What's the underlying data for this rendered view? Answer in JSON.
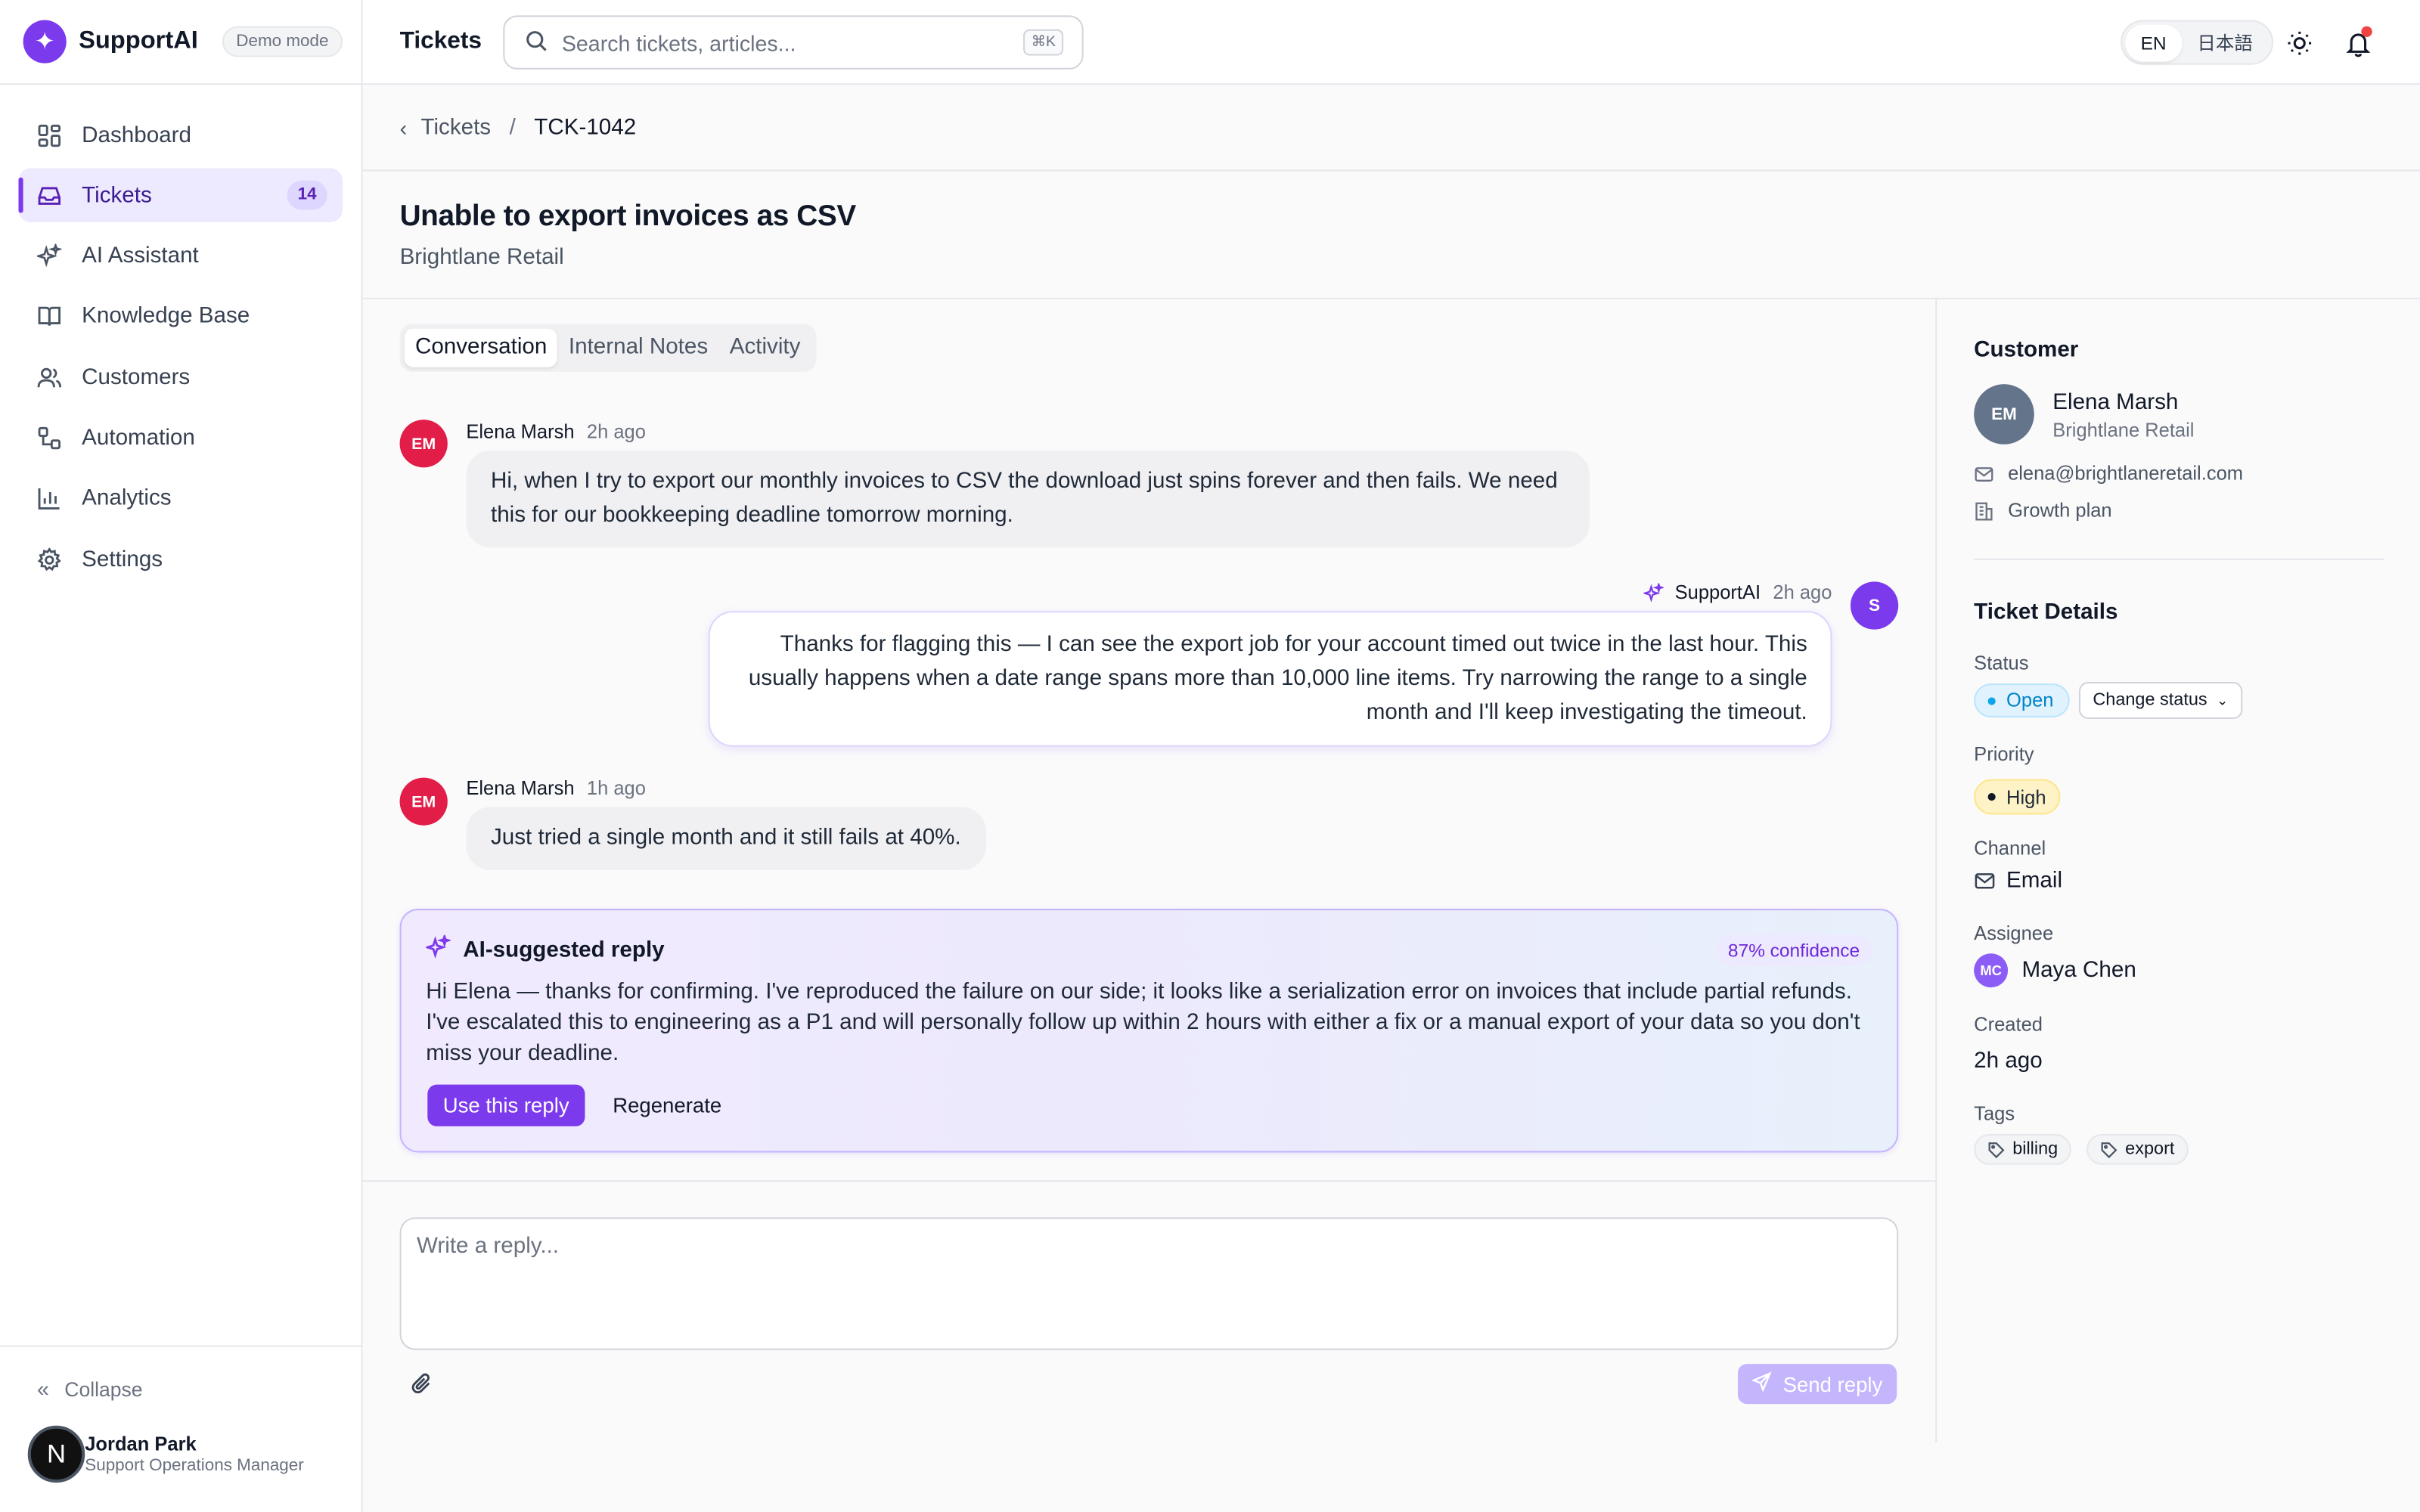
{
  "app": {
    "brand": "SupportAI",
    "mode_badge": "Demo mode",
    "accent": "#7c3aed"
  },
  "sidebar": {
    "items": [
      {
        "label": "Dashboard",
        "icon": "dashboard-icon"
      },
      {
        "label": "Tickets",
        "icon": "inbox-icon",
        "count": "14",
        "active": true
      },
      {
        "label": "AI Assistant",
        "icon": "sparkles-icon"
      },
      {
        "label": "Knowledge Base",
        "icon": "book-icon"
      },
      {
        "label": "Customers",
        "icon": "users-icon"
      },
      {
        "label": "Automation",
        "icon": "workflow-icon"
      },
      {
        "label": "Analytics",
        "icon": "bar-chart-icon"
      },
      {
        "label": "Settings",
        "icon": "gear-icon"
      }
    ],
    "collapse_label": "Collapse",
    "user": {
      "initial": "N",
      "name": "Jordan Park",
      "role": "Support Operations Manager"
    }
  },
  "header": {
    "title": "Tickets",
    "search_placeholder": "Search tickets, articles...",
    "search_shortcut": "⌘K",
    "languages": [
      "EN",
      "日本語"
    ],
    "active_language": "EN"
  },
  "breadcrumb": {
    "parent": "Tickets",
    "separator": "/",
    "current": "TCK-1042"
  },
  "ticket": {
    "title": "Unable to export invoices as CSV",
    "company": "Brightlane Retail"
  },
  "tabs": [
    "Conversation",
    "Internal Notes",
    "Activity"
  ],
  "messages": [
    {
      "author": "Elena Marsh",
      "initials": "EM",
      "time": "2h ago",
      "text": "Hi, when I try to export our monthly invoices to CSV the download just spins forever and then fails. We need this for our bookkeeping deadline tomorrow morning."
    },
    {
      "author": "SupportAI",
      "initials": "S",
      "time": "2h ago",
      "text": "Thanks for flagging this — I can see the export job for your account timed out twice in the last hour. This usually happens when a date range spans more than 10,000 line items. Try narrowing the range to a single month and I'll keep investigating the timeout."
    },
    {
      "author": "Elena Marsh",
      "initials": "EM",
      "time": "1h ago",
      "text": "Just tried a single month and it still fails at 40%."
    }
  ],
  "ai_suggestion": {
    "title": "AI-suggested reply",
    "confidence": "87% confidence",
    "text": "Hi Elena — thanks for confirming. I've reproduced the failure on our side; it looks like a serialization error on invoices that include partial refunds. I've escalated this to engineering as a P1 and will personally follow up within 2 hours with either a fix or a manual export of your data so you don't miss your deadline.",
    "use_label": "Use this reply",
    "regenerate_label": "Regenerate"
  },
  "composer": {
    "placeholder": "Write a reply...",
    "send_label": "Send reply"
  },
  "customer_panel": {
    "heading": "Customer",
    "initials": "EM",
    "name": "Elena Marsh",
    "company": "Brightlane Retail",
    "email": "elena@brightlaneretail.com",
    "plan": "Growth plan"
  },
  "details": {
    "heading": "Ticket Details",
    "status_label": "Status",
    "status": "Open",
    "status_color": "#0284c7",
    "change_status_label": "Change status",
    "priority_label": "Priority",
    "priority": "High",
    "priority_color": "#fef3c7",
    "channel_label": "Channel",
    "channel": "Email",
    "assignee_label": "Assignee",
    "assignee_initials": "MC",
    "assignee": "Maya Chen",
    "created_label": "Created",
    "created": "2h ago",
    "tags_label": "Tags",
    "tags": [
      "billing",
      "export"
    ]
  }
}
